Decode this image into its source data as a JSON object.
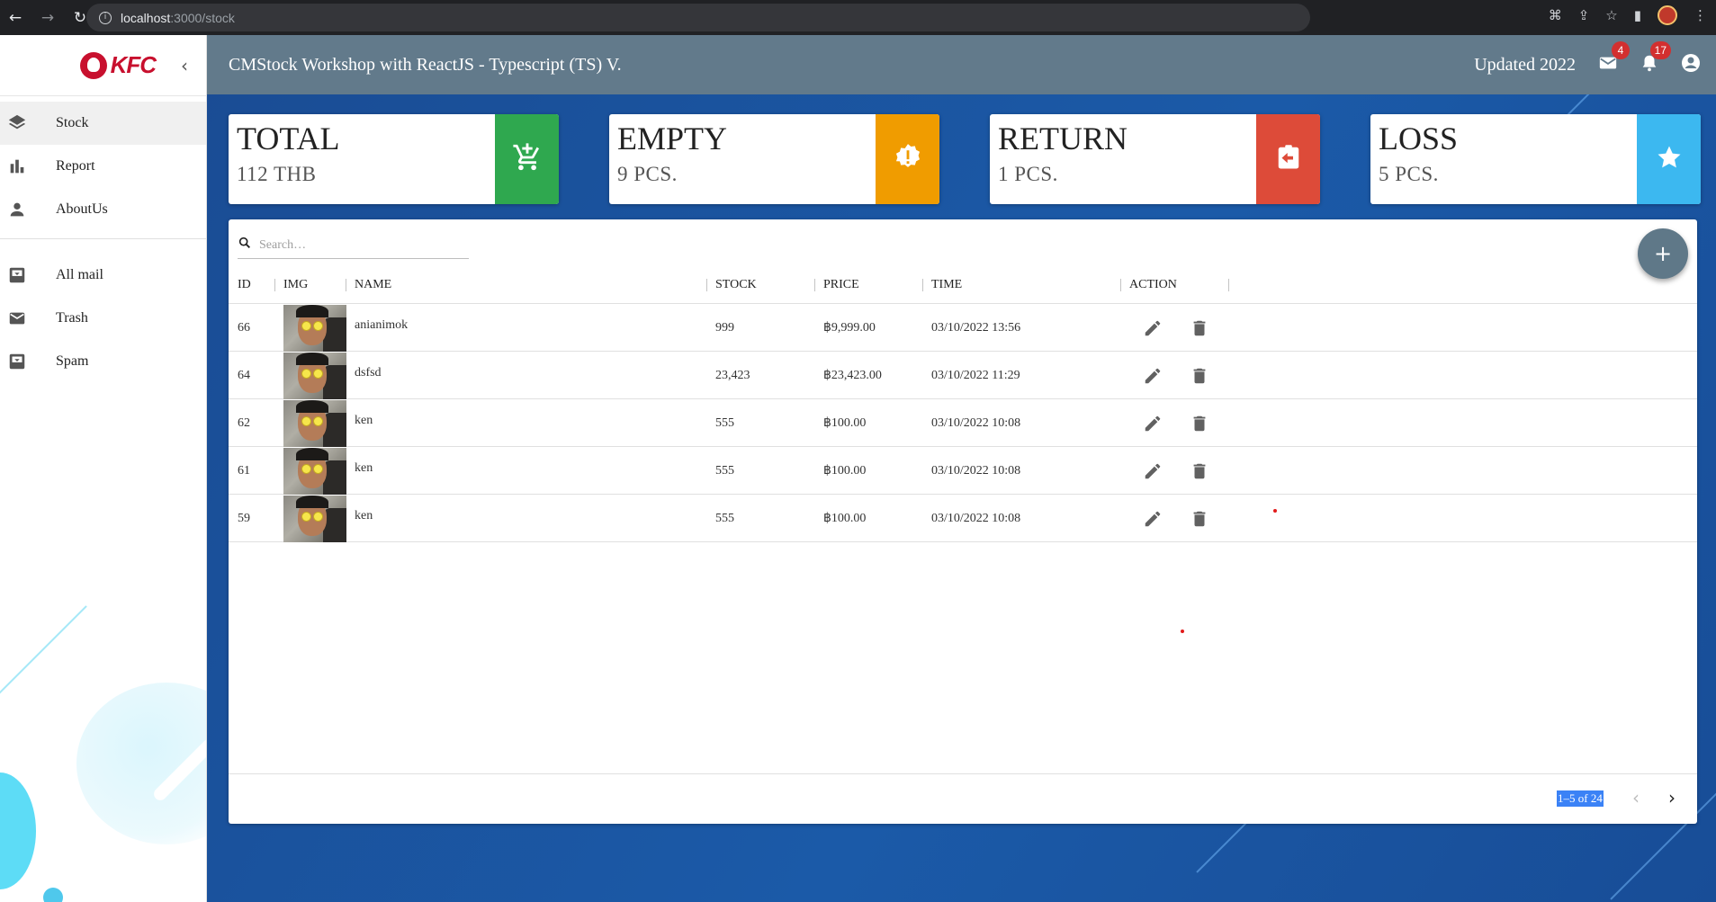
{
  "browser": {
    "url_host": "localhost",
    "url_path": ":3000/stock"
  },
  "sidebar": {
    "logo_text": "KFC",
    "items": [
      {
        "label": "Stock",
        "icon": "layers-icon",
        "active": true
      },
      {
        "label": "Report",
        "icon": "bar-chart-icon",
        "active": false
      },
      {
        "label": "AboutUs",
        "icon": "person-icon",
        "active": false
      }
    ],
    "mail_items": [
      {
        "label": "All mail",
        "icon": "inbox-icon"
      },
      {
        "label": "Trash",
        "icon": "mail-icon"
      },
      {
        "label": "Spam",
        "icon": "inbox-icon"
      }
    ]
  },
  "header": {
    "title": "CMStock Workshop with ReactJS - Typescript (TS) V.",
    "updated": "Updated 2022",
    "mail_badge": "4",
    "notif_badge": "17"
  },
  "cards": [
    {
      "label": "TOTAL",
      "value": "112 THB",
      "color": "#2fa84f",
      "icon": "cart-add-icon"
    },
    {
      "label": "EMPTY",
      "value": "9 PCS.",
      "color": "#f09c00",
      "icon": "alert-badge-icon"
    },
    {
      "label": "RETURN",
      "value": "1 PCS.",
      "color": "#dd4b39",
      "icon": "assignment-return-icon"
    },
    {
      "label": "LOSS",
      "value": "5 PCS.",
      "color": "#3cb8f0",
      "icon": "star-icon"
    }
  ],
  "table": {
    "search_placeholder": "Search…",
    "columns": [
      "ID",
      "IMG",
      "NAME",
      "STOCK",
      "PRICE",
      "TIME",
      "ACTION"
    ],
    "rows": [
      {
        "id": "66",
        "name": "anianimok",
        "stock": "999",
        "price": "฿9,999.00",
        "time": "03/10/2022 13:56"
      },
      {
        "id": "64",
        "name": "dsfsd",
        "stock": "23,423",
        "price": "฿23,423.00",
        "time": "03/10/2022 11:29"
      },
      {
        "id": "62",
        "name": "ken",
        "stock": "555",
        "price": "฿100.00",
        "time": "03/10/2022 10:08"
      },
      {
        "id": "61",
        "name": "ken",
        "stock": "555",
        "price": "฿100.00",
        "time": "03/10/2022 10:08"
      },
      {
        "id": "59",
        "name": "ken",
        "stock": "555",
        "price": "฿100.00",
        "time": "03/10/2022 10:08"
      }
    ],
    "pagination": "1–5 of 24"
  }
}
